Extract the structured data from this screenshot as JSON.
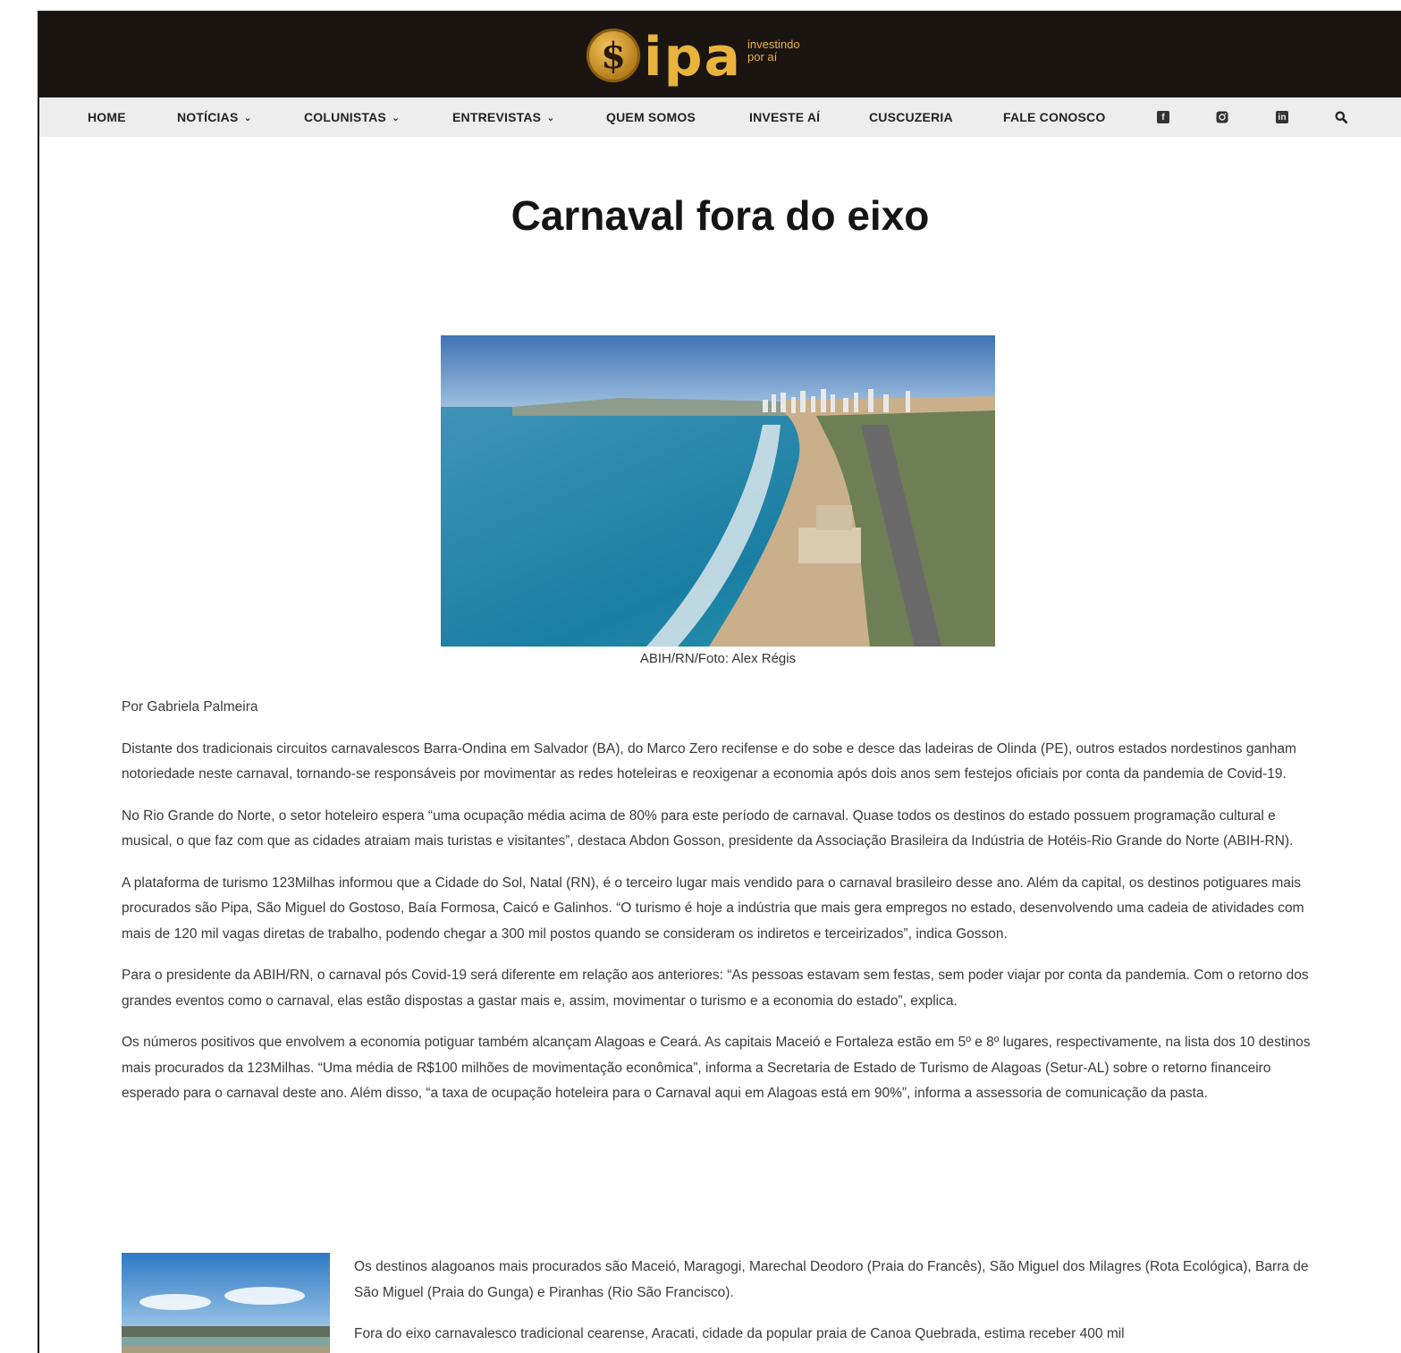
{
  "brand": {
    "coin_symbol": "$",
    "wordmark": "ipa",
    "tagline_1": "investindo",
    "tagline_2": "por aí",
    "accent": "#e9b43d",
    "header_bg": "#1b1512"
  },
  "nav": {
    "items": [
      {
        "label": "HOME",
        "dropdown": false
      },
      {
        "label": "NOTÍCIAS",
        "dropdown": true
      },
      {
        "label": "COLUNISTAS",
        "dropdown": true
      },
      {
        "label": "ENTREVISTAS",
        "dropdown": true
      },
      {
        "label": "QUEM SOMOS",
        "dropdown": false
      },
      {
        "label": "INVESTE AÍ",
        "dropdown": false
      },
      {
        "label": "CUSCUZERIA",
        "dropdown": false
      },
      {
        "label": "FALE CONOSCO",
        "dropdown": false
      }
    ],
    "chevron": "⌄",
    "icons": [
      "facebook-icon",
      "instagram-icon",
      "linkedin-icon",
      "search-icon"
    ]
  },
  "article": {
    "title": "Carnaval fora do eixo",
    "image_caption": "ABIH/RN/Foto: Alex Régis",
    "byline": "Por Gabriela Palmeira",
    "paragraphs": [
      "Distante dos tradicionais circuitos carnavalescos Barra-Ondina em Salvador (BA), do Marco Zero recifense e do sobe e desce das ladeiras de Olinda (PE), outros estados nordestinos ganham notoriedade neste carnaval, tornando-se responsáveis por movimentar as redes hoteleiras e reoxigenar a economia após dois anos sem festejos oficiais por conta da pandemia de Covid-19.",
      "No Rio Grande do Norte, o setor hoteleiro espera “uma ocupação média acima de 80% para este período de carnaval. Quase todos os destinos do estado possuem programação cultural e musical, o que faz com que as cidades atraiam mais turistas e visitantes”, destaca Abdon Gosson, presidente da Associação Brasileira da Indústria de Hotéis-Rio Grande do Norte (ABIH-RN).",
      "A plataforma de turismo 123Milhas informou que a Cidade do Sol, Natal (RN), é o terceiro lugar mais vendido para o carnaval brasileiro desse ano. Além da capital, os destinos potiguares mais procurados são Pipa, São Miguel do Gostoso, Baía Formosa, Caicó e Galinhos. “O turismo é hoje a indústria que mais gera empregos no estado, desenvolvendo uma cadeia de atividades com mais de 120 mil vagas diretas de trabalho, podendo chegar a 300 mil postos quando se consideram os indiretos e terceirizados”, indica Gosson.",
      "Para o presidente da ABIH/RN, o carnaval pós Covid-19 será diferente em relação aos anteriores: “As pessoas estavam sem festas, sem poder viajar por conta da pandemia. Com o retorno dos grandes eventos como o carnaval, elas estão dispostas a gastar mais e, assim, movimentar o turismo e a economia do estado”, explica.",
      "Os números positivos que envolvem a economia potiguar também alcançam Alagoas e Ceará. As capitais Maceió e Fortaleza estão em 5º e 8º lugares, respectivamente, na lista dos 10 destinos mais procurados da 123Milhas. “Uma média de R$100 milhões de movimentação econômica”, informa a Secretaria de Estado de Turismo de Alagoas (Setur-AL) sobre o retorno financeiro esperado para o carnaval deste ano. Além disso, “a taxa de ocupação hoteleira para o Carnaval aqui em Alagoas está em 90%”, informa a assessoria de comunicação da pasta."
    ],
    "side_paragraphs": [
      "Os destinos alagoanos mais procurados são Maceió, Maragogi, Marechal Deodoro (Praia do Francês), São Miguel dos Milagres (Rota Ecológica), Barra de São Miguel (Praia do Gunga) e Piranhas (Rio São Francisco).",
      "Fora do eixo carnavalesco tradicional cearense, Aracati, cidade da popular praia de Canoa Quebrada, estima receber 400 mil"
    ]
  }
}
